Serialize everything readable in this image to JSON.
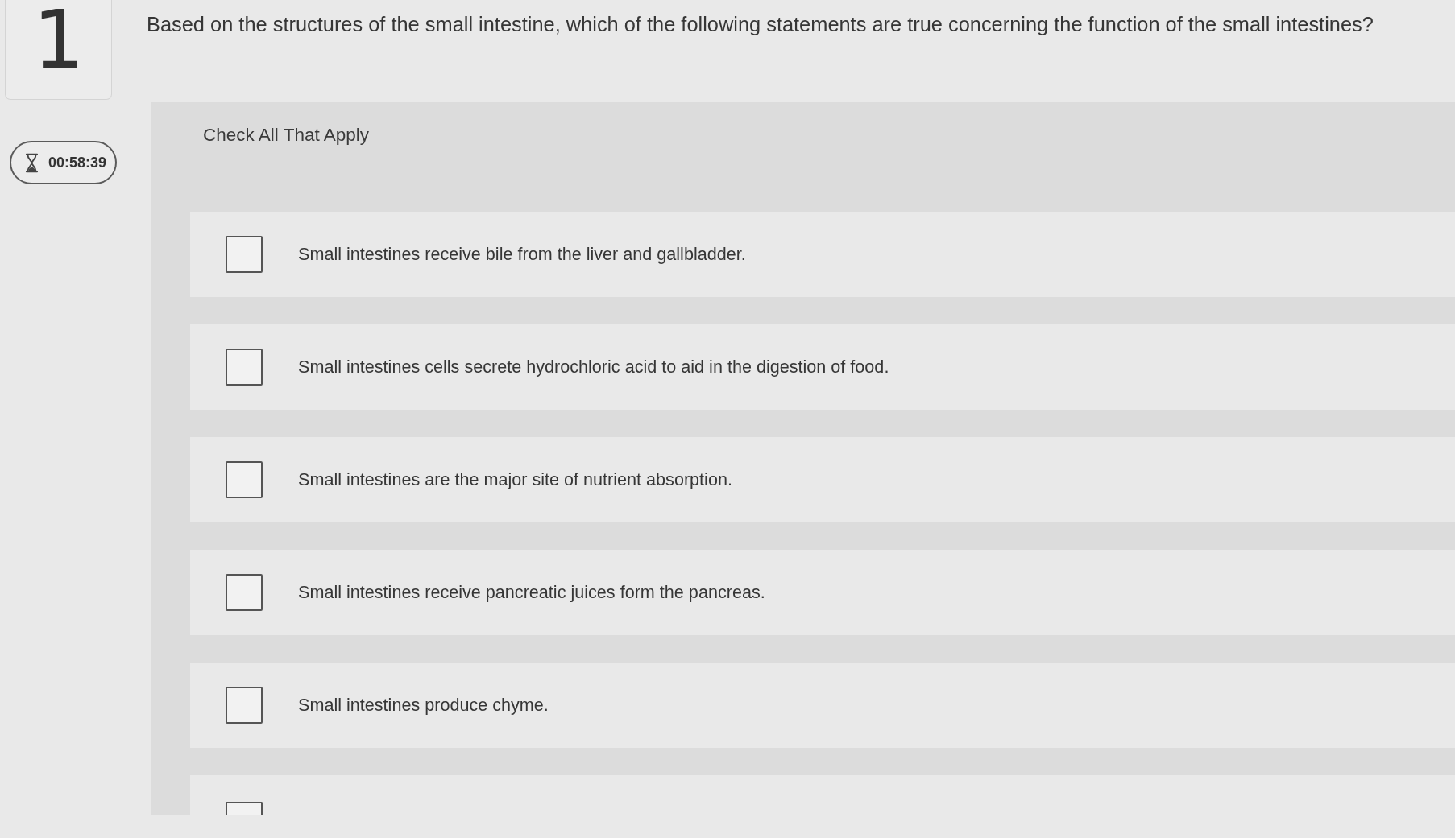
{
  "question": {
    "number": "1",
    "text": "Based on the structures of the small intestine, which of the following statements are true concerning the function of the small intestines?"
  },
  "timer": {
    "time": "00:58:39"
  },
  "answers": {
    "instruction": "Check All That Apply",
    "options": [
      {
        "label": "Small intestines receive bile from the liver and gallbladder.",
        "checked": false
      },
      {
        "label": "Small intestines cells secrete hydrochloric acid to aid in the digestion of food.",
        "checked": false
      },
      {
        "label": "Small intestines are the major site of nutrient absorption.",
        "checked": false
      },
      {
        "label": "Small intestines receive pancreatic juices form the pancreas.",
        "checked": false
      },
      {
        "label": "Small intestines produce chyme.",
        "checked": false
      },
      {
        "checked": false
      }
    ]
  }
}
